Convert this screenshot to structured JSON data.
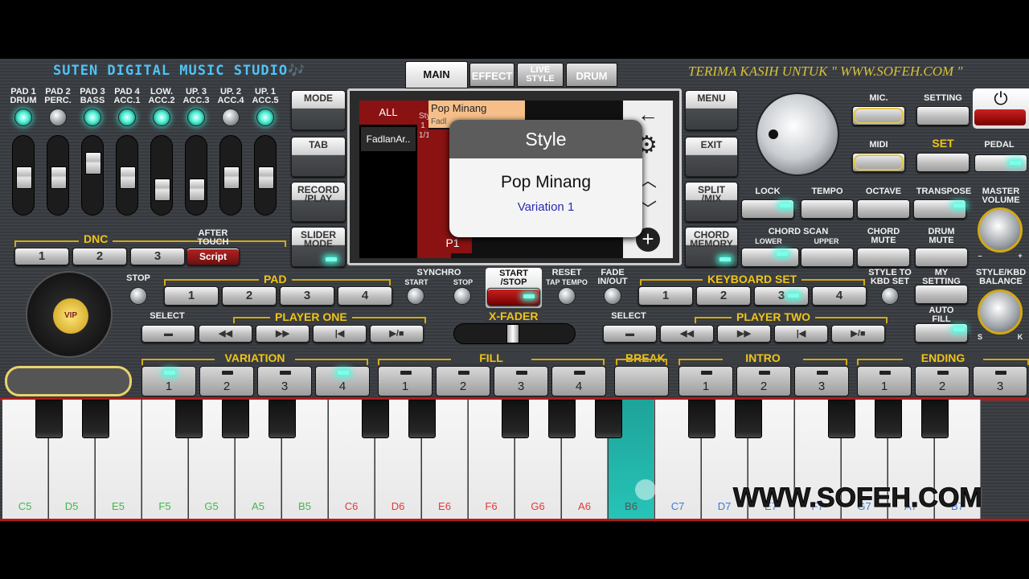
{
  "header": {
    "studio_title": "SUTEN DIGITAL MUSIC STUDIO🎶",
    "thanks": "TERIMA KASIH UNTUK \" WWW.SOFEH.COM \""
  },
  "tabs": [
    {
      "label": "MAIN"
    },
    {
      "label": "EFFECT"
    },
    {
      "label": "LIVE STYLE"
    },
    {
      "label": "DRUM"
    }
  ],
  "pads": [
    {
      "label": "PAD 1\nDRUM",
      "on": true
    },
    {
      "label": "PAD 2\nPERC.",
      "on": false
    },
    {
      "label": "PAD 3\nBASS",
      "on": true
    },
    {
      "label": "PAD 4\nACC.1",
      "on": true
    },
    {
      "label": "LOW.\nACC.2",
      "on": true
    },
    {
      "label": "UP. 3\nACC.3",
      "on": true
    },
    {
      "label": "UP. 2\nACC.4",
      "on": false
    },
    {
      "label": "UP. 1\nACC.5",
      "on": true
    }
  ],
  "fader_levels": [
    0.5,
    0.5,
    0.2,
    0.5,
    0.75,
    0.75,
    0.5,
    0.5
  ],
  "dnc": {
    "title": "DNC",
    "buttons": [
      "1",
      "2",
      "3"
    ],
    "after_touch": "AFTER\nTOUCH",
    "script": "Script"
  },
  "left_buttons": [
    "MODE",
    "TAB",
    "RECORD\n/PLAY",
    "SLIDER\nMODE"
  ],
  "right_buttons": [
    "MENU",
    "EXIT",
    "SPLIT\n/MIX",
    "CHORD\nMEMORY"
  ],
  "screen": {
    "all": "ALL",
    "bank": "FadlanAr..",
    "style_name": "Pop Minang",
    "style_sub": "Fadl",
    "vert_text": "Style\n1\n1/1",
    "p1": "P1"
  },
  "dialog": {
    "title": "Style",
    "style_name": "Pop Minang",
    "variation": "Variation 1"
  },
  "right_panel": {
    "mic": "MIC.",
    "setting": "SETTING",
    "midi": "MIDI",
    "set": "SET",
    "pedal": "PEDAL",
    "lock": "LOCK",
    "tempo": "TEMPO",
    "octave": "OCTAVE",
    "transpose": "TRANSPOSE",
    "master_volume": "MASTER\nVOLUME",
    "chord_scan": "CHORD SCAN",
    "lower": "LOWER",
    "upper": "UPPER",
    "chord_mute": "CHORD\nMUTE",
    "drum_mute": "DRUM\nMUTE",
    "style_to_kbd": "STYLE TO\nKBD SET",
    "my_setting": "MY\nSETTING",
    "auto_fill": "AUTO\nFILL",
    "style_kbd_balance": "STYLE/KBD\nBALANCE",
    "keyboard_set": "KEYBOARD SET",
    "kbd_buttons": [
      "1",
      "2",
      "3",
      "4"
    ],
    "s": "S",
    "k": "K",
    "minus": "–",
    "plus": "+"
  },
  "pad_section": {
    "stop": "STOP",
    "pad": "PAD",
    "buttons": [
      "1",
      "2",
      "3",
      "4"
    ],
    "synchro": "SYNCHRO",
    "start": "START",
    "stop_small": "STOP",
    "start_stop": "START\n/STOP",
    "reset": "RESET",
    "tap_tempo": "TAP TEMPO",
    "fade": "FADE\nIN/OUT"
  },
  "player_one": {
    "select": "SELECT",
    "title": "PLAYER ONE"
  },
  "player_two": {
    "select": "SELECT",
    "title": "PLAYER TWO"
  },
  "xfader": "X-FADER",
  "sections": {
    "variation": "VARIATION",
    "fill": "FILL",
    "break": "BREAK",
    "intro": "INTRO",
    "ending": "ENDING"
  },
  "variation_buttons": [
    "1",
    "2",
    "3",
    "4"
  ],
  "fill_buttons": [
    "1",
    "2",
    "3",
    "4"
  ],
  "intro_buttons": [
    "1",
    "2",
    "3"
  ],
  "ending_buttons": [
    "1",
    "2",
    "3"
  ],
  "keys": [
    "C5",
    "D5",
    "E5",
    "F5",
    "G5",
    "A5",
    "B5",
    "C6",
    "D6",
    "E6",
    "F6",
    "G6",
    "A6",
    "B6",
    "C7",
    "D7",
    "E7",
    "F7",
    "G7",
    "A7",
    "B7"
  ],
  "key_colors": [
    "#3fb84b",
    "#3fb84b",
    "#3fb84b",
    "#3fb84b",
    "#3fb84b",
    "#3fb84b",
    "#3fb84b",
    "#e23a3a",
    "#e23a3a",
    "#e23a3a",
    "#e23a3a",
    "#e23a3a",
    "#e23a3a",
    "#555",
    "#3b7ae0",
    "#3b7ae0",
    "#3b7ae0",
    "#3b7ae0",
    "#3b7ae0",
    "#3b7ae0",
    "#3b7ae0"
  ],
  "active_key": "B6",
  "watermark": "WWW.SOFEH.COM",
  "vip": "VIP"
}
